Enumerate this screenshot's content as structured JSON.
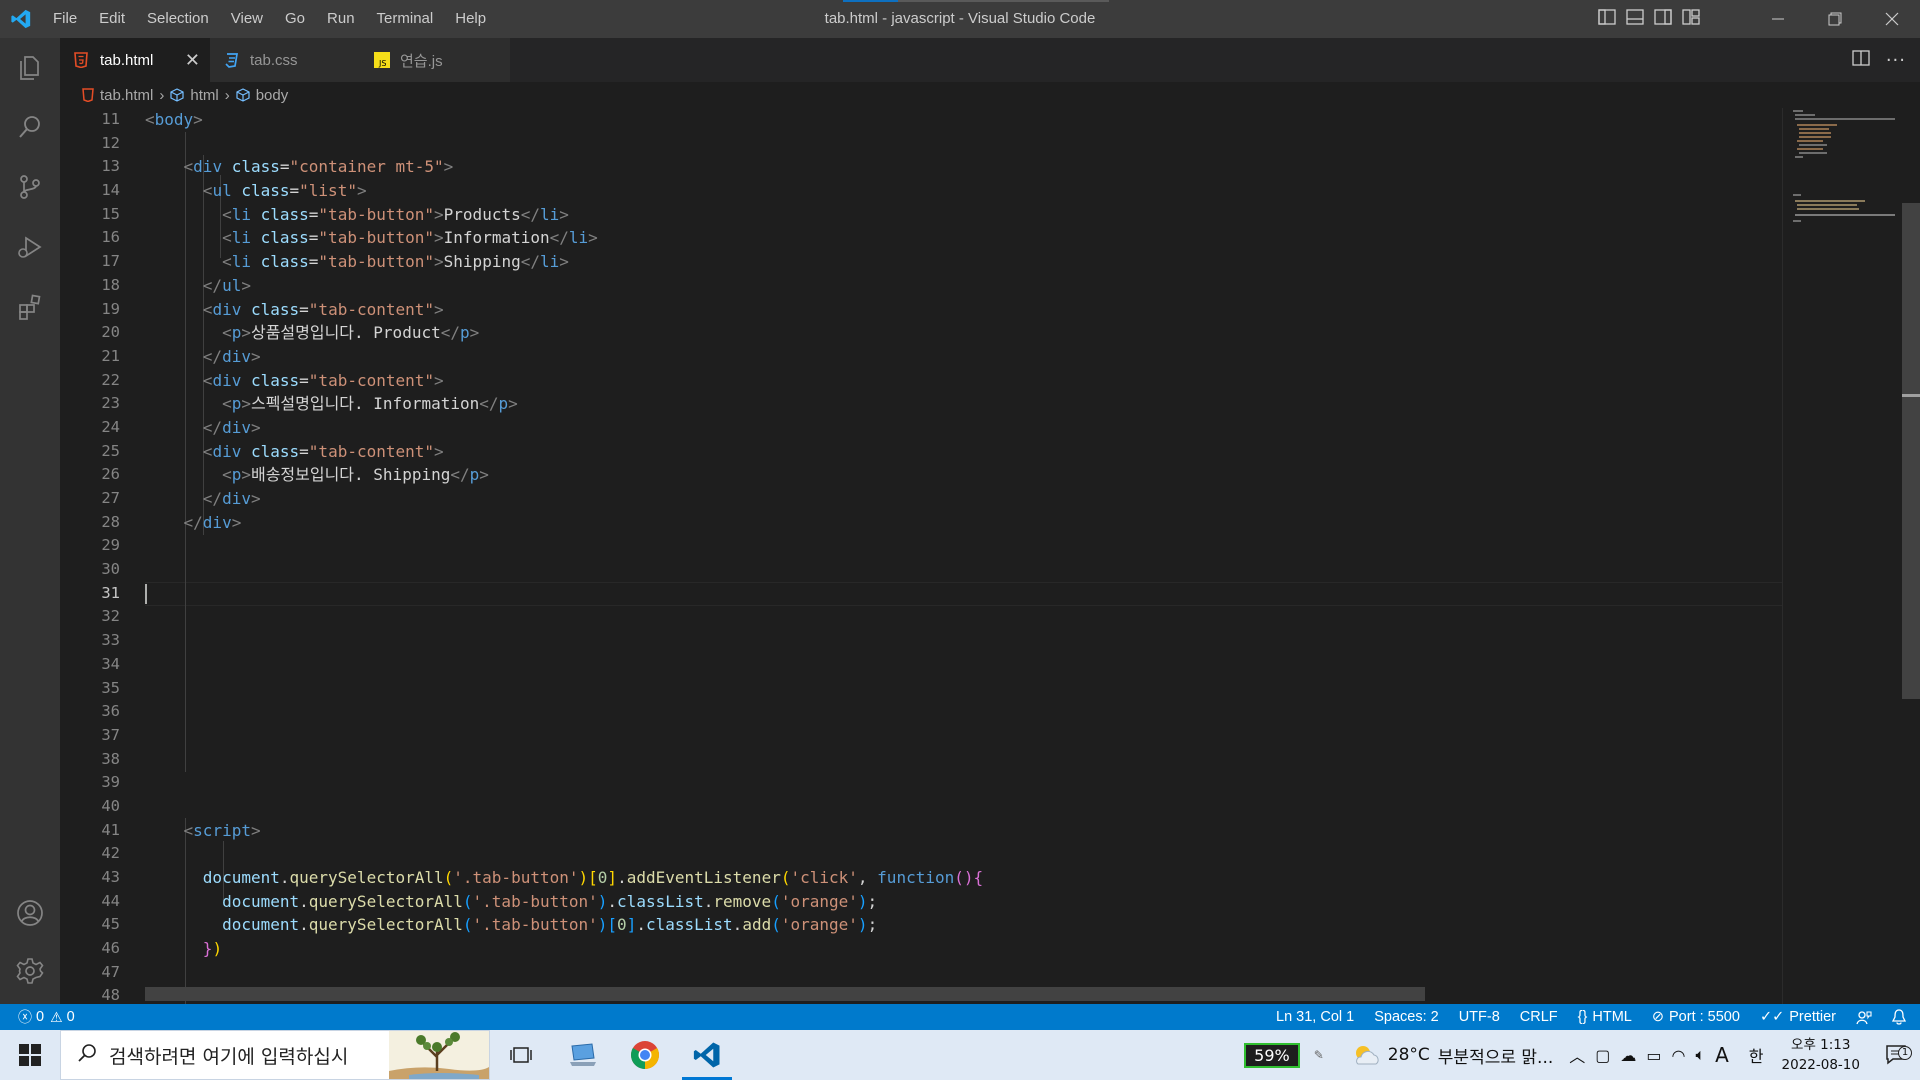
{
  "window": {
    "title": "tab.html - javascript - Visual Studio Code",
    "menu": [
      "File",
      "Edit",
      "Selection",
      "View",
      "Go",
      "Run",
      "Terminal",
      "Help"
    ]
  },
  "tabs": [
    {
      "label": "tab.html",
      "icon": "html-file-icon",
      "active": true
    },
    {
      "label": "tab.css",
      "icon": "css-file-icon",
      "active": false
    },
    {
      "label": "연습.js",
      "icon": "js-file-icon",
      "active": false
    }
  ],
  "breadcrumb": [
    "tab.html",
    "html",
    "body"
  ],
  "editor": {
    "first_line": 11,
    "current_line": 31,
    "line_numbers": [
      "11",
      "12",
      "13",
      "14",
      "15",
      "16",
      "17",
      "18",
      "19",
      "20",
      "21",
      "22",
      "23",
      "24",
      "25",
      "26",
      "27",
      "28",
      "29",
      "30",
      "31",
      "32",
      "33",
      "34",
      "35",
      "36",
      "37",
      "38",
      "39",
      "40",
      "41",
      "42",
      "43",
      "44",
      "45",
      "46",
      "47",
      "48"
    ],
    "lines": [
      [
        [
          "tg",
          "<"
        ],
        [
          "tn",
          "body"
        ],
        [
          "tg",
          ">"
        ]
      ],
      [],
      [
        [
          "t",
          "    "
        ],
        [
          "tg",
          "<"
        ],
        [
          "tn",
          "div"
        ],
        [
          "t",
          " "
        ],
        [
          "at",
          "class"
        ],
        [
          "t",
          "="
        ],
        [
          "sv",
          "\"container mt-5\""
        ],
        [
          "tg",
          ">"
        ]
      ],
      [
        [
          "t",
          "      "
        ],
        [
          "tg",
          "<"
        ],
        [
          "tn",
          "ul"
        ],
        [
          "t",
          " "
        ],
        [
          "at",
          "class"
        ],
        [
          "t",
          "="
        ],
        [
          "sv",
          "\"list\""
        ],
        [
          "tg",
          ">"
        ]
      ],
      [
        [
          "t",
          "        "
        ],
        [
          "tg",
          "<"
        ],
        [
          "tn",
          "li"
        ],
        [
          "t",
          " "
        ],
        [
          "at",
          "class"
        ],
        [
          "t",
          "="
        ],
        [
          "sv",
          "\"tab-button\""
        ],
        [
          "tg",
          ">"
        ],
        [
          "t",
          "Products"
        ],
        [
          "tg",
          "</"
        ],
        [
          "tn",
          "li"
        ],
        [
          "tg",
          ">"
        ]
      ],
      [
        [
          "t",
          "        "
        ],
        [
          "tg",
          "<"
        ],
        [
          "tn",
          "li"
        ],
        [
          "t",
          " "
        ],
        [
          "at",
          "class"
        ],
        [
          "t",
          "="
        ],
        [
          "sv",
          "\"tab-button\""
        ],
        [
          "tg",
          ">"
        ],
        [
          "t",
          "Information"
        ],
        [
          "tg",
          "</"
        ],
        [
          "tn",
          "li"
        ],
        [
          "tg",
          ">"
        ]
      ],
      [
        [
          "t",
          "        "
        ],
        [
          "tg",
          "<"
        ],
        [
          "tn",
          "li"
        ],
        [
          "t",
          " "
        ],
        [
          "at",
          "class"
        ],
        [
          "t",
          "="
        ],
        [
          "sv",
          "\"tab-button\""
        ],
        [
          "tg",
          ">"
        ],
        [
          "t",
          "Shipping"
        ],
        [
          "tg",
          "</"
        ],
        [
          "tn",
          "li"
        ],
        [
          "tg",
          ">"
        ]
      ],
      [
        [
          "t",
          "      "
        ],
        [
          "tg",
          "</"
        ],
        [
          "tn",
          "ul"
        ],
        [
          "tg",
          ">"
        ]
      ],
      [
        [
          "t",
          "      "
        ],
        [
          "tg",
          "<"
        ],
        [
          "tn",
          "div"
        ],
        [
          "t",
          " "
        ],
        [
          "at",
          "class"
        ],
        [
          "t",
          "="
        ],
        [
          "sv",
          "\"tab-content\""
        ],
        [
          "tg",
          ">"
        ]
      ],
      [
        [
          "t",
          "        "
        ],
        [
          "tg",
          "<"
        ],
        [
          "tn",
          "p"
        ],
        [
          "tg",
          ">"
        ],
        [
          "t",
          "상품설명입니다. Product"
        ],
        [
          "tg",
          "</"
        ],
        [
          "tn",
          "p"
        ],
        [
          "tg",
          ">"
        ]
      ],
      [
        [
          "t",
          "      "
        ],
        [
          "tg",
          "</"
        ],
        [
          "tn",
          "div"
        ],
        [
          "tg",
          ">"
        ]
      ],
      [
        [
          "t",
          "      "
        ],
        [
          "tg",
          "<"
        ],
        [
          "tn",
          "div"
        ],
        [
          "t",
          " "
        ],
        [
          "at",
          "class"
        ],
        [
          "t",
          "="
        ],
        [
          "sv",
          "\"tab-content\""
        ],
        [
          "tg",
          ">"
        ]
      ],
      [
        [
          "t",
          "        "
        ],
        [
          "tg",
          "<"
        ],
        [
          "tn",
          "p"
        ],
        [
          "tg",
          ">"
        ],
        [
          "t",
          "스펙설명입니다. Information"
        ],
        [
          "tg",
          "</"
        ],
        [
          "tn",
          "p"
        ],
        [
          "tg",
          ">"
        ]
      ],
      [
        [
          "t",
          "      "
        ],
        [
          "tg",
          "</"
        ],
        [
          "tn",
          "div"
        ],
        [
          "tg",
          ">"
        ]
      ],
      [
        [
          "t",
          "      "
        ],
        [
          "tg",
          "<"
        ],
        [
          "tn",
          "div"
        ],
        [
          "t",
          " "
        ],
        [
          "at",
          "class"
        ],
        [
          "t",
          "="
        ],
        [
          "sv",
          "\"tab-content\""
        ],
        [
          "tg",
          ">"
        ]
      ],
      [
        [
          "t",
          "        "
        ],
        [
          "tg",
          "<"
        ],
        [
          "tn",
          "p"
        ],
        [
          "tg",
          ">"
        ],
        [
          "t",
          "배송정보입니다. Shipping"
        ],
        [
          "tg",
          "</"
        ],
        [
          "tn",
          "p"
        ],
        [
          "tg",
          ">"
        ]
      ],
      [
        [
          "t",
          "      "
        ],
        [
          "tg",
          "</"
        ],
        [
          "tn",
          "div"
        ],
        [
          "tg",
          ">"
        ]
      ],
      [
        [
          "t",
          "    "
        ],
        [
          "tg",
          "</"
        ],
        [
          "tn",
          "div"
        ],
        [
          "tg",
          ">"
        ]
      ],
      [],
      [],
      [],
      [],
      [],
      [],
      [],
      [],
      [],
      [],
      [],
      [],
      [
        [
          "t",
          "    "
        ],
        [
          "tg",
          "<"
        ],
        [
          "tn",
          "script"
        ],
        [
          "tg",
          ">"
        ]
      ],
      [],
      [
        [
          "t",
          "      "
        ],
        [
          "vr",
          "document"
        ],
        [
          "t",
          "."
        ],
        [
          "fn",
          "querySelectorAll"
        ],
        [
          "b1",
          "("
        ],
        [
          "sv",
          "'.tab-button'"
        ],
        [
          "b1",
          ")"
        ],
        [
          "b1",
          "["
        ],
        [
          "nm",
          "0"
        ],
        [
          "b1",
          "]"
        ],
        [
          "t",
          "."
        ],
        [
          "fn",
          "addEventListener"
        ],
        [
          "b1",
          "("
        ],
        [
          "sv",
          "'click'"
        ],
        [
          "t",
          ", "
        ],
        [
          "kw",
          "function"
        ],
        [
          "b2",
          "()"
        ],
        [
          "b2",
          "{"
        ]
      ],
      [
        [
          "t",
          "        "
        ],
        [
          "vr",
          "document"
        ],
        [
          "t",
          "."
        ],
        [
          "fn",
          "querySelectorAll"
        ],
        [
          "b3",
          "("
        ],
        [
          "sv",
          "'.tab-button'"
        ],
        [
          "b3",
          ")"
        ],
        [
          "t",
          "."
        ],
        [
          "vr",
          "classList"
        ],
        [
          "t",
          "."
        ],
        [
          "fn",
          "remove"
        ],
        [
          "b3",
          "("
        ],
        [
          "sv",
          "'orange'"
        ],
        [
          "b3",
          ")"
        ],
        [
          "t",
          ";"
        ]
      ],
      [
        [
          "t",
          "        "
        ],
        [
          "vr",
          "document"
        ],
        [
          "t",
          "."
        ],
        [
          "fn",
          "querySelectorAll"
        ],
        [
          "b3",
          "("
        ],
        [
          "sv",
          "'.tab-button'"
        ],
        [
          "b3",
          ")"
        ],
        [
          "b3",
          "["
        ],
        [
          "nm",
          "0"
        ],
        [
          "b3",
          "]"
        ],
        [
          "t",
          "."
        ],
        [
          "vr",
          "classList"
        ],
        [
          "t",
          "."
        ],
        [
          "fn",
          "add"
        ],
        [
          "b3",
          "("
        ],
        [
          "sv",
          "'orange'"
        ],
        [
          "b3",
          ")"
        ],
        [
          "t",
          ";"
        ]
      ],
      [
        [
          "t",
          "      "
        ],
        [
          "b2",
          "}"
        ],
        [
          "b1",
          ")"
        ]
      ],
      [],
      []
    ]
  },
  "statusbar": {
    "errors": "0",
    "warnings": "0",
    "position": "Ln 31, Col 1",
    "spaces": "Spaces: 2",
    "encoding": "UTF-8",
    "eol": "CRLF",
    "language": "HTML",
    "port": "Port : 5500",
    "prettier": "Prettier"
  },
  "taskbar": {
    "search_placeholder": "검색하려면 여기에 입력하십시",
    "battery": "59%",
    "temperature": "28°C",
    "weather": "부분적으로 맑...",
    "ime": "한",
    "font_indicator": "A",
    "time": "오후 1:13",
    "date": "2022-08-10",
    "notifications": "1"
  },
  "colors": {
    "accent": "#007acc",
    "titlebar": "#3c3c3c",
    "editor_bg": "#1e1e1e",
    "activitybar": "#333333"
  }
}
